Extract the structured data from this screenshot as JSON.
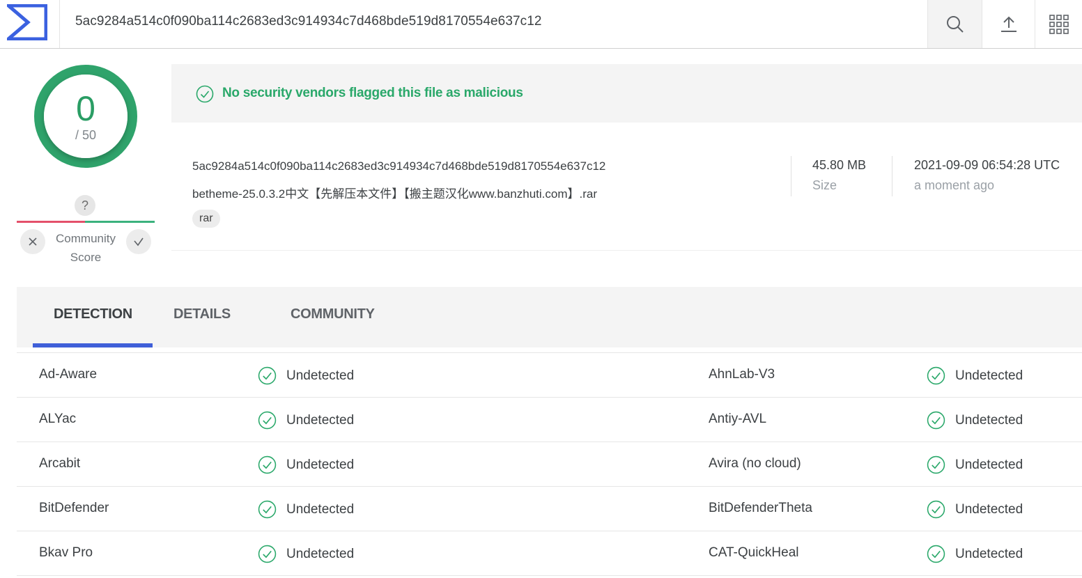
{
  "header": {
    "search_value": "5ac9284a514c0f090ba114c2683ed3c914934c7d468bde519d8170554e637c12"
  },
  "score": {
    "detections": "0",
    "total": "/ 50"
  },
  "community": {
    "unknown_symbol": "?",
    "label_line1": "Community",
    "label_line2": "Score"
  },
  "banner": {
    "text": "No security vendors flagged this file as malicious"
  },
  "file": {
    "hash": "5ac9284a514c0f090ba114c2683ed3c914934c7d468bde519d8170554e637c12",
    "name": "betheme-25.0.3.2中文【先解压本文件】【搬主题汉化www.banzhuti.com】.rar",
    "tag": "rar",
    "size_value": "45.80 MB",
    "size_label": "Size",
    "date_value": "2021-09-09 06:54:28 UTC",
    "date_label": "a moment ago"
  },
  "tabs": [
    {
      "label": "DETECTION"
    },
    {
      "label": "DETAILS"
    },
    {
      "label": "COMMUNITY"
    }
  ],
  "colors": {
    "clean": "#2aa86a",
    "accent": "#3f5fd8",
    "negative": "#e4506a"
  },
  "detections": [
    {
      "left_vendor": "Ad-Aware",
      "left_result": "Undetected",
      "right_vendor": "AhnLab-V3",
      "right_result": "Undetected"
    },
    {
      "left_vendor": "ALYac",
      "left_result": "Undetected",
      "right_vendor": "Antiy-AVL",
      "right_result": "Undetected"
    },
    {
      "left_vendor": "Arcabit",
      "left_result": "Undetected",
      "right_vendor": "Avira (no cloud)",
      "right_result": "Undetected"
    },
    {
      "left_vendor": "BitDefender",
      "left_result": "Undetected",
      "right_vendor": "BitDefenderTheta",
      "right_result": "Undetected"
    },
    {
      "left_vendor": "Bkav Pro",
      "left_result": "Undetected",
      "right_vendor": "CAT-QuickHeal",
      "right_result": "Undetected"
    }
  ]
}
